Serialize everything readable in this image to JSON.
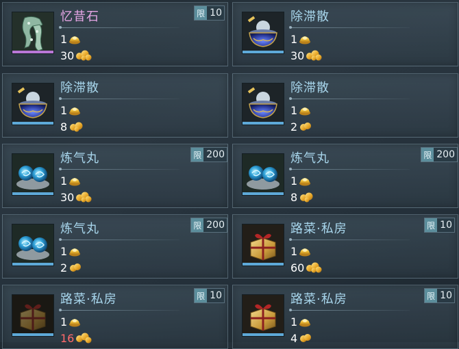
{
  "items": [
    {
      "name": "忆昔石",
      "limit_tag": "限",
      "limit": "10",
      "line1": "1",
      "line2": "30",
      "icon": "jade-pendant-icon"
    },
    {
      "name": "除滞散",
      "limit_tag": "",
      "limit": "",
      "line1": "1",
      "line2": "30",
      "icon": "elixir-bowl-icon"
    },
    {
      "name": "除滞散",
      "limit_tag": "",
      "limit": "",
      "line1": "1",
      "line2": "8",
      "icon": "elixir-bowl-icon"
    },
    {
      "name": "除滞散",
      "limit_tag": "",
      "limit": "",
      "line1": "1",
      "line2": "2",
      "icon": "elixir-bowl-icon"
    },
    {
      "name": "炼气丸",
      "limit_tag": "限",
      "limit": "200",
      "line1": "1",
      "line2": "30",
      "icon": "qi-pill-icon"
    },
    {
      "name": "炼气丸",
      "limit_tag": "限",
      "limit": "200",
      "line1": "1",
      "line2": "8",
      "icon": "qi-pill-icon"
    },
    {
      "name": "炼气丸",
      "limit_tag": "限",
      "limit": "200",
      "line1": "1",
      "line2": "2",
      "icon": "qi-pill-icon"
    },
    {
      "name": "路菜·私房",
      "limit_tag": "限",
      "limit": "10",
      "line1": "1",
      "line2": "60",
      "icon": "gift-box-icon"
    },
    {
      "name": "路菜·私房",
      "limit_tag": "限",
      "limit": "10",
      "line1": "1",
      "line2": "16",
      "icon": "gift-box-icon"
    },
    {
      "name": "路菜·私房",
      "limit_tag": "限",
      "limit": "10",
      "line1": "1",
      "line2": "4",
      "icon": "gift-box-icon"
    }
  ],
  "colors": {
    "name_blue": "#a8d6ec",
    "name_purple": "#e6a6e6",
    "price_red": "#ff6a6a",
    "limit_tag_bg": "#5c8e9c"
  }
}
